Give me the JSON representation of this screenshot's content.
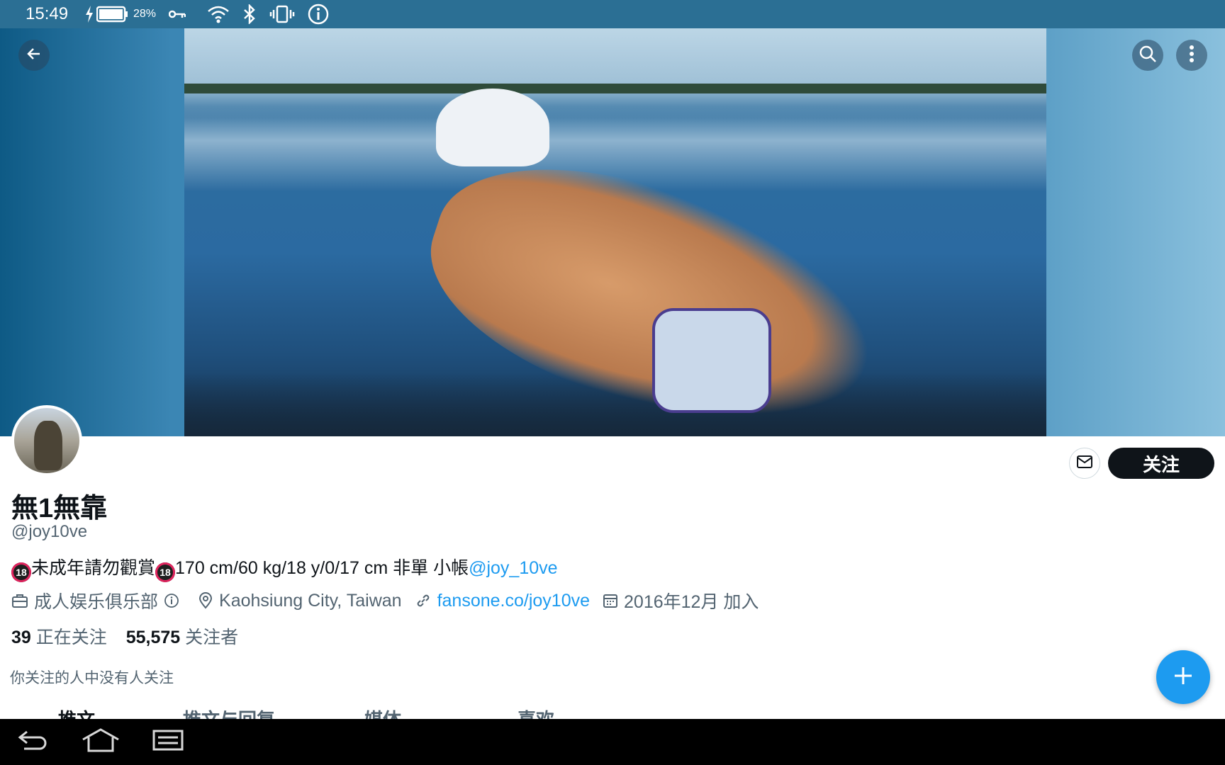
{
  "status_bar": {
    "time": "15:49",
    "battery_percent": "28%",
    "icons": [
      "charging-icon",
      "battery-icon",
      "vpn-key-icon",
      "wifi-icon",
      "bluetooth-icon",
      "vibrate-icon",
      "info-icon"
    ]
  },
  "header": {
    "back_icon": "arrow-left-icon",
    "search_icon": "search-icon",
    "more_icon": "more-vertical-icon"
  },
  "profile": {
    "display_name": "無1無靠",
    "handle": "@joy10ve",
    "bio": {
      "badge": "18",
      "text_1": "未成年請勿觀賞",
      "text_2": "170 cm/60 kg/18 y/0/17 cm 非單 小帳",
      "mention": "@joy_10ve"
    },
    "category": "成人娱乐俱乐部",
    "location": "Kaohsiung City, Taiwan",
    "website": "fansone.co/joy10ve",
    "joined": "2016年12月 加入",
    "following_count": "39",
    "following_label": "正在关注",
    "followers_count": "55,575",
    "followers_label": "关注者",
    "followers_note": "你关注的人中没有人关注"
  },
  "actions": {
    "follow_label": "关注"
  },
  "tabs": [
    {
      "label": "推文"
    },
    {
      "label": "推文与回复"
    },
    {
      "label": "媒体"
    },
    {
      "label": "喜欢"
    }
  ],
  "colors": {
    "status_bar": "#2b6f94",
    "accent": "#1d9bf0",
    "follow_button": "#0f1419",
    "secondary_text": "#536471"
  }
}
